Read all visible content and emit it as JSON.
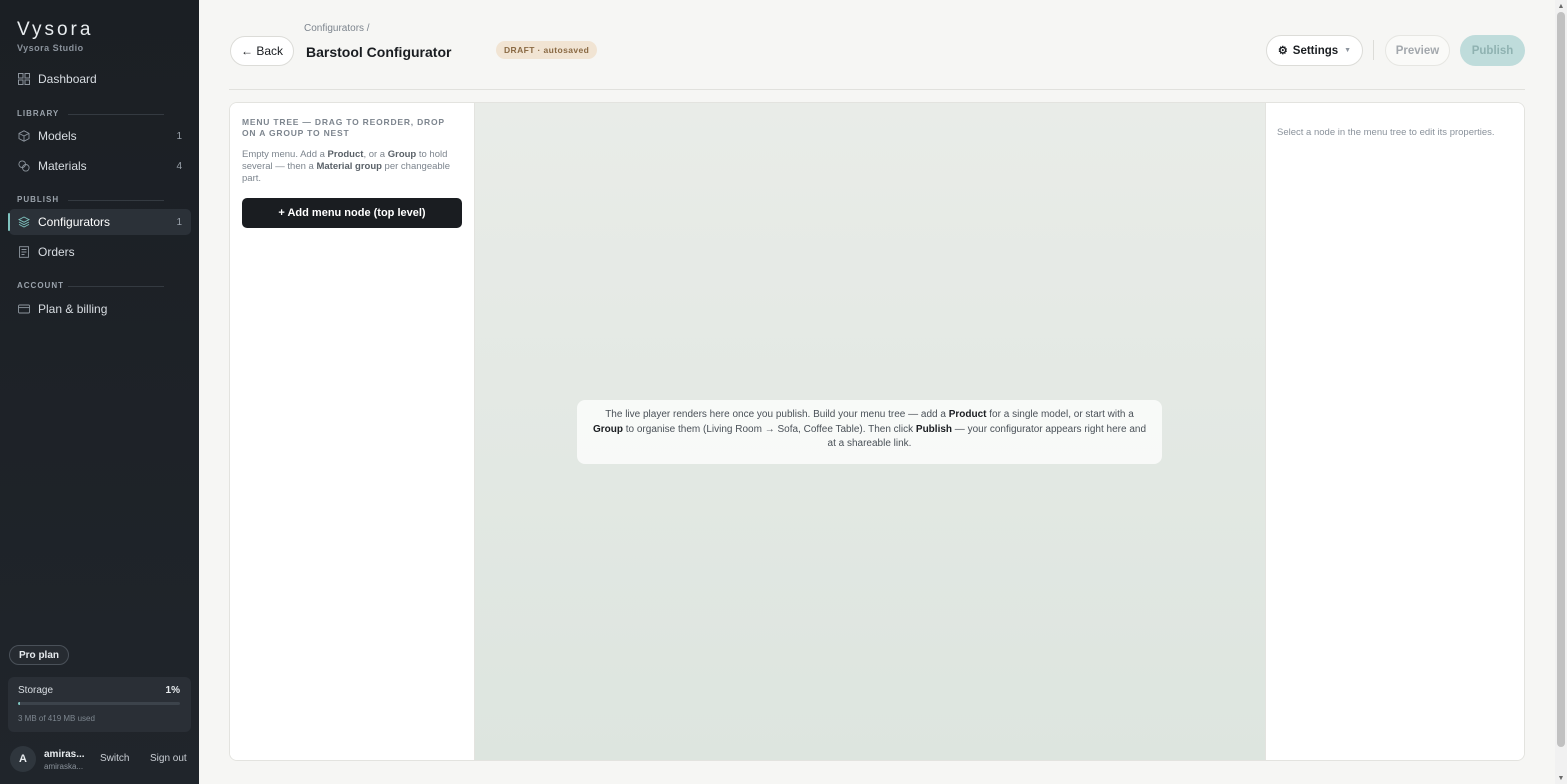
{
  "sidebar": {
    "brand": "Vysora",
    "brand_sub": "Vysora Studio",
    "dashboard": {
      "label": "Dashboard",
      "icon": "grid-icon"
    },
    "sections": {
      "library": "LIBRARY",
      "publish": "PUBLISH",
      "account": "ACCOUNT"
    },
    "models": {
      "label": "Models",
      "count": "1",
      "icon": "cube-icon"
    },
    "materials": {
      "label": "Materials",
      "count": "4",
      "icon": "swatches-icon"
    },
    "configurators": {
      "label": "Configurators",
      "count": "1",
      "icon": "layers-icon",
      "active": true
    },
    "orders": {
      "label": "Orders",
      "icon": "receipt-icon"
    },
    "billing": {
      "label": "Plan & billing",
      "icon": "card-icon"
    },
    "plan_badge": "Pro plan",
    "storage": {
      "title": "Storage",
      "percent_label": "1%",
      "fraction_used": 0.01,
      "used_text": "3 MB of 419 MB used"
    },
    "user": {
      "initial": "A",
      "name": "amiras...",
      "email": "amiraska...",
      "switch_label": "Switch",
      "signout_label": "Sign out"
    }
  },
  "header": {
    "breadcrumb": "Configurators  /",
    "back_label": "← Back",
    "title": "Barstool Configurator",
    "status_badge": "DRAFT · autosaved",
    "settings_label": "Settings",
    "preview_label": "Preview",
    "publish_label": "Publish"
  },
  "tree": {
    "title": "MENU TREE — DRAG TO REORDER, DROP ON A GROUP TO NEST",
    "help": {
      "p1": "Empty menu. Add a ",
      "b1": "Product",
      "p2": ", or a ",
      "b2": "Group",
      "p3": " to hold several — then a ",
      "b3": "Material group",
      "p4": " per changeable part."
    },
    "add_button": "+ Add menu node (top level)"
  },
  "canvas": {
    "p1": "The live player renders here once you publish. Build your menu tree — add a ",
    "b1": "Product",
    "p2": " for a single model, or start with a ",
    "b2": "Group",
    "p3": " to organise them (Living Room → Sofa, Coffee Table). Then click ",
    "b3": "Publish",
    "p4": " — your configurator appears right here and at a shareable link."
  },
  "props": {
    "hint": "Select a node in the menu tree to edit its properties."
  },
  "colors": {
    "sidebar_bg": "#1b1f24",
    "accent": "#7fc3bf",
    "publish_disabled": "#bfdcdb",
    "draft_badge_bg": "#f1e4d3"
  }
}
